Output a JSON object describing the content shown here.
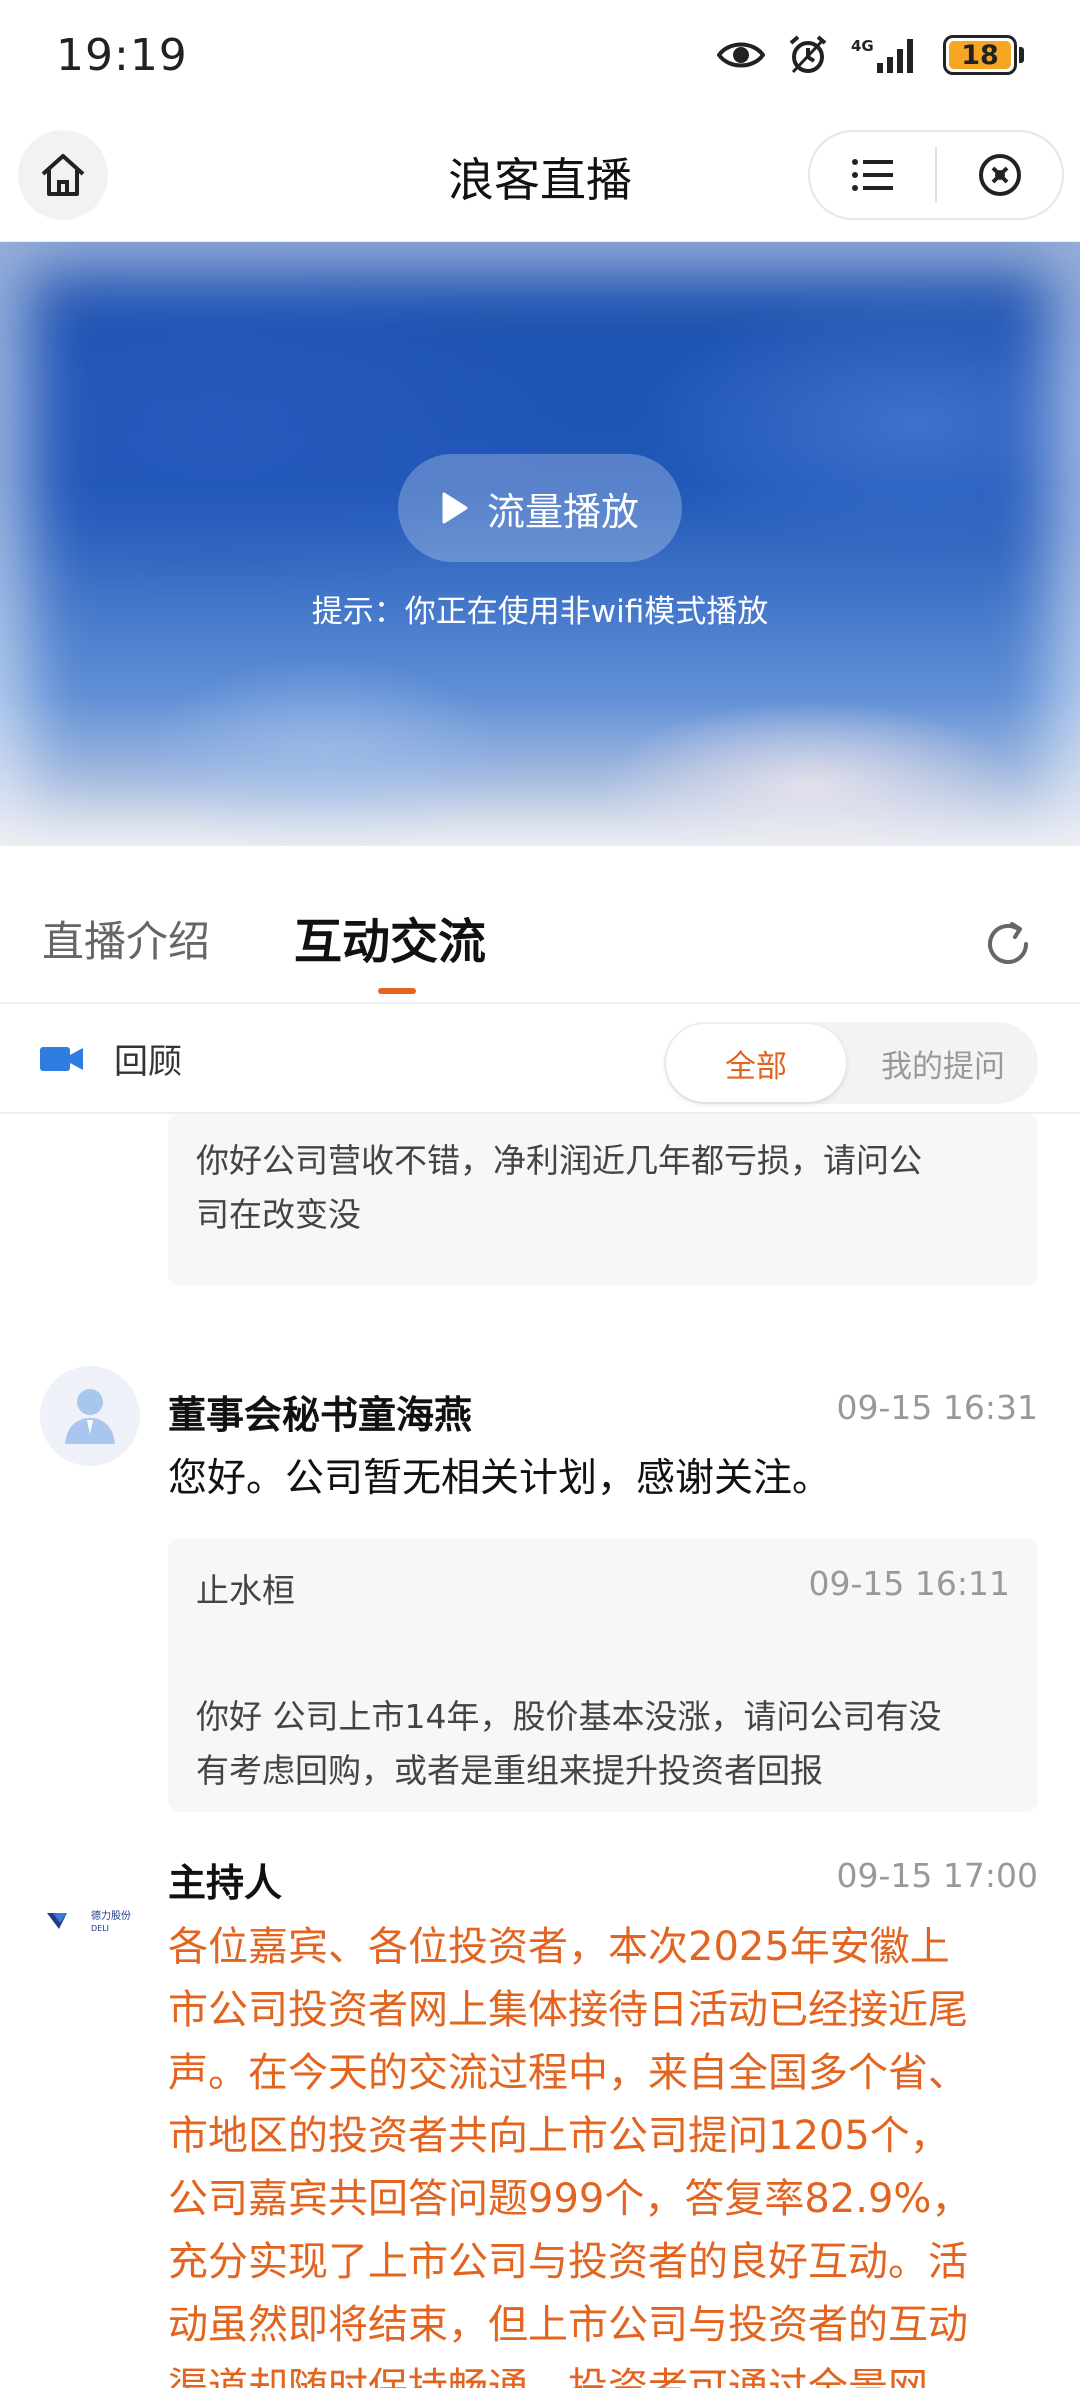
{
  "status_bar": {
    "time": "19:19",
    "network": "4G",
    "battery": "18",
    "icons": [
      "eye-icon",
      "alarm-icon",
      "signal-icon",
      "battery-icon"
    ]
  },
  "nav": {
    "title": "浪客直播",
    "home_icon": "home-icon",
    "menu_icon": "list-icon",
    "close_icon": "close-circle-icon"
  },
  "video": {
    "play_label": "流量播放",
    "hint": "提示：你正在使用非wifi模式播放"
  },
  "tabs": {
    "items": [
      {
        "label": "直播介绍",
        "active": false
      },
      {
        "label": "互动交流",
        "active": true
      }
    ],
    "accent": "#e2641f"
  },
  "filter": {
    "review_label": "回顾",
    "segments": [
      {
        "label": "全部",
        "active": true
      },
      {
        "label": "我的提问",
        "active": false
      }
    ]
  },
  "feed": {
    "top_quote": {
      "text_line1": "你好公司营收不错，净利润近几年都亏损，请问公",
      "text_line2": "司在改变没"
    },
    "reply1": {
      "name": "董事会秘书童海燕",
      "time": "09-15 16:31",
      "text": "您好。公司暂无相关计划，感谢关注。",
      "quote": {
        "name": "止水桓",
        "time": "09-15 16:11",
        "text_line1": "你好 公司上市14年，股价基本没涨，请问公司有没",
        "text_line2": "有考虑回购，或者是重组来提升投资者回报"
      }
    },
    "reply2": {
      "name": "主持人",
      "time": "09-15 17:00",
      "logo_text": "德力股份",
      "logo_sub": "DELI",
      "lines": [
        "各位嘉宾、各位投资者，本次2025年安徽上",
        "市公司投资者网上集体接待日活动已经接近尾",
        "声。在今天的交流过程中，来自全国多个省、",
        "市地区的投资者共向上市公司提问1205个，",
        "公司嘉宾共回答问题999个，答复率82.9%，",
        "充分实现了上市公司与投资者的良好互动。活",
        "动虽然即将结束，但上市公司与投资者的互动",
        "渠道却随时保持畅通，投资者可通过全景网"
      ]
    }
  }
}
